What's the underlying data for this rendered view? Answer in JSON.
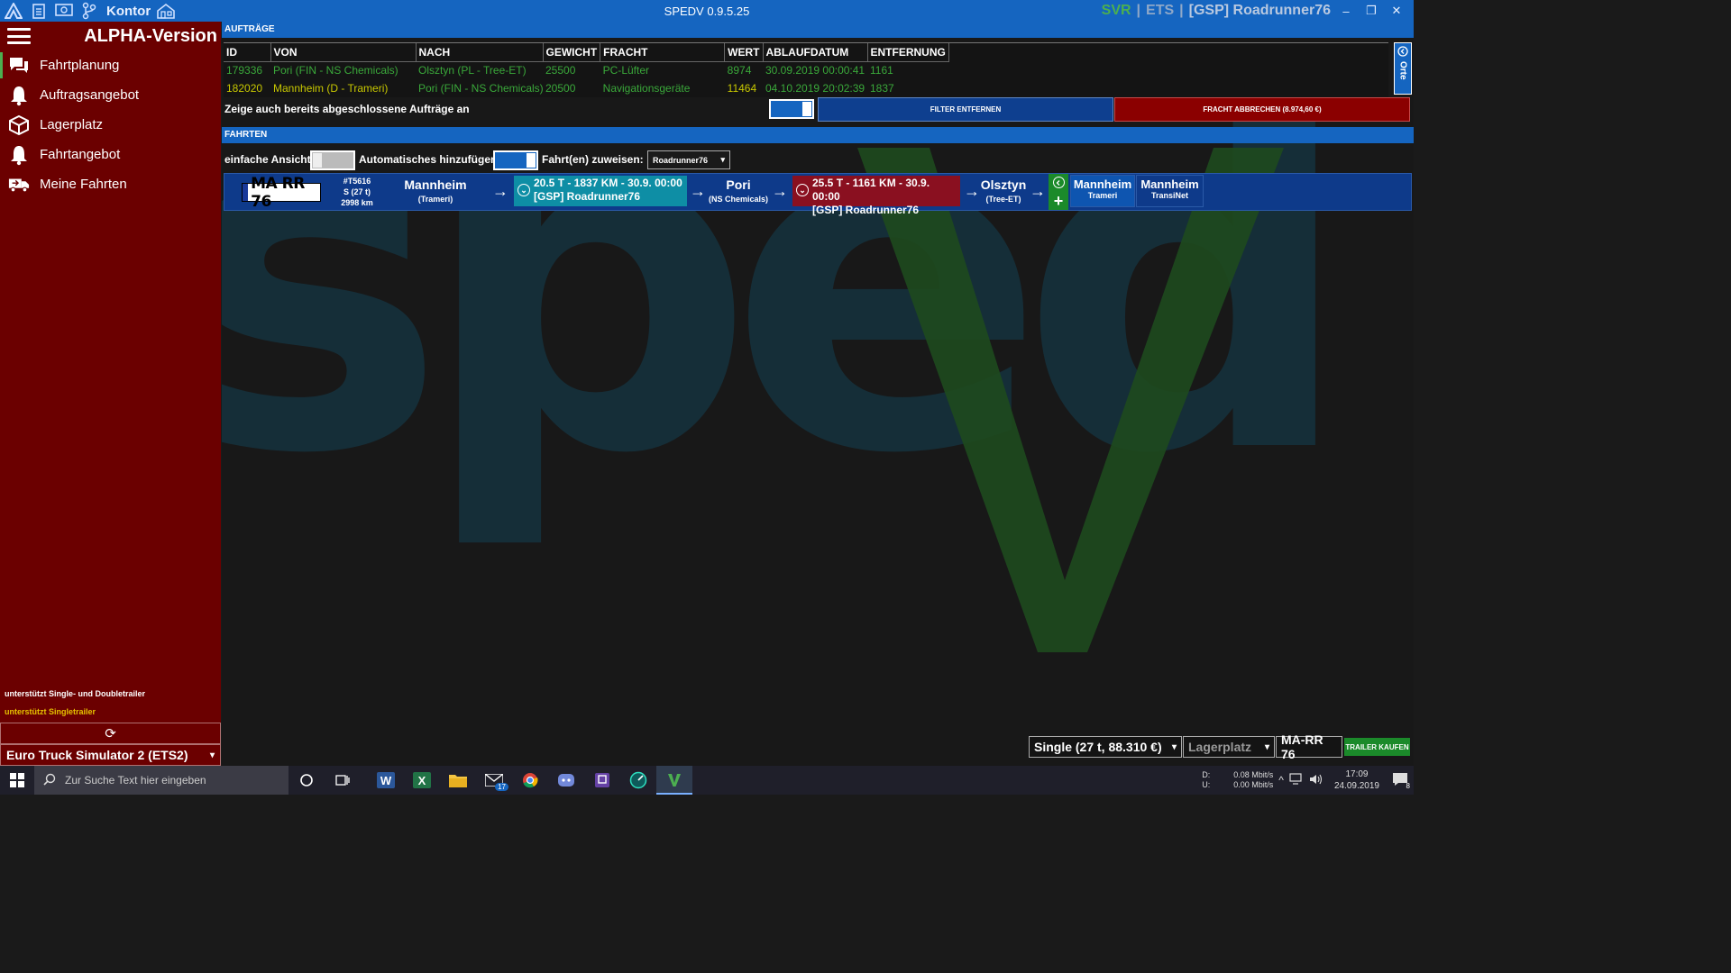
{
  "titlebar": {
    "kontor": "Kontor",
    "app_title": "SPEDV 0.9.5.25",
    "svr": "SVR",
    "separator": "|",
    "ets": "ETS",
    "user": "[GSP] Roadrunner76",
    "minimize": "‒",
    "restore": "❐",
    "close": "✕"
  },
  "sidebar": {
    "title": "ALPHA-Version",
    "items": [
      {
        "label": "Fahrtplanung",
        "icon": "chat-icon"
      },
      {
        "label": "Auftragsangebot",
        "icon": "bell-icon"
      },
      {
        "label": "Lagerplatz",
        "icon": "box-icon"
      },
      {
        "label": "Fahrtangebot",
        "icon": "bell-icon"
      },
      {
        "label": "Meine Fahrten",
        "icon": "truck-icon"
      }
    ],
    "note_double": "unterstützt Single- und Doubletrailer",
    "note_single": "unterstützt Singletrailer",
    "refresh_glyph": "⟳",
    "game": "Euro Truck Simulator 2 (ETS2)",
    "game_caret": "▾"
  },
  "orders": {
    "section": "AUFTRÄGE",
    "headers": [
      "ID",
      "VON",
      "NACH",
      "GEWICHT",
      "FRACHT",
      "WERT",
      "ABLAUFDATUM",
      "ENTFERNUNG"
    ],
    "rows": [
      [
        "179336",
        "Pori (FIN - NS Chemicals)",
        "Olsztyn (PL - Tree-ET)",
        "25500",
        "PC-Lüfter",
        "8974",
        "30.09.2019 00:00:41",
        "1161"
      ],
      [
        "182020",
        "Mannheim (D - Trameri)",
        "Pori (FIN - NS Chemicals)",
        "20500",
        "Navigationsgeräte",
        "11464",
        "04.10.2019 20:02:39",
        "1837"
      ]
    ],
    "orte": "Orte",
    "show_done": "Zeige auch bereits abgeschlossene Aufträge an",
    "filter_button": "FILTER ENTFERNEN",
    "cancel_button": "FRACHT ABBRECHEN (8.974,60 €)"
  },
  "trips": {
    "section": "FAHRTEN",
    "simple_view": "einfache Ansicht",
    "auto_add": "Automatisches hinzufügen",
    "assign_label": "Fahrt(en) zuweisen:",
    "assign_value": "Roadrunner76",
    "caret": "▾",
    "row": {
      "plate": "MA RR 76",
      "trip_id": "#T5616",
      "trailer": "S (27 t)",
      "km": "2998 km",
      "start_city": "Mannheim",
      "start_sub": "(Trameri)",
      "leg1_line1": "20.5 T - 1837 KM - 30.9. 00:00",
      "leg1_line2": "[GSP] Roadrunner76",
      "stop2_city": "Pori",
      "stop2_sub": "(NS Chemicals)",
      "leg2_line1": "25.5 T - 1161 KM - 30.9. 00:00",
      "leg2_line2": "[GSP] Roadrunner76",
      "stop3_city": "Olsztyn",
      "stop3_sub": "(Tree-ET)",
      "end1_city": "Mannheim",
      "end1_sub": "Trameri",
      "end2_city": "Mannheim",
      "end2_sub": "TransiNet",
      "arrow": "→",
      "chevron": "⌄",
      "plus": "+"
    }
  },
  "bottom": {
    "trailer_select": "Single (27 t, 88.310 €)",
    "storage_select": "Lagerplatz",
    "plate": "MA-RR 76",
    "buy_button": "TRAILER KAUFEN",
    "caret": "▾"
  },
  "taskbar": {
    "search_placeholder": "Zur Suche Text hier eingeben",
    "net_d_label": "D:",
    "net_u_label": "U:",
    "net_d": "0.08 Mbit/s",
    "net_u": "0.00 Mbit/s",
    "time": "17:09",
    "date": "24.09.2019",
    "mail_badge": "17",
    "notif_badge": "8"
  },
  "colors": {
    "accent": "#1565c0",
    "sidebar": "#6b0000",
    "green": "#4caf50",
    "teal_leg": "#0e8ea5",
    "red_leg": "#8a1020"
  }
}
